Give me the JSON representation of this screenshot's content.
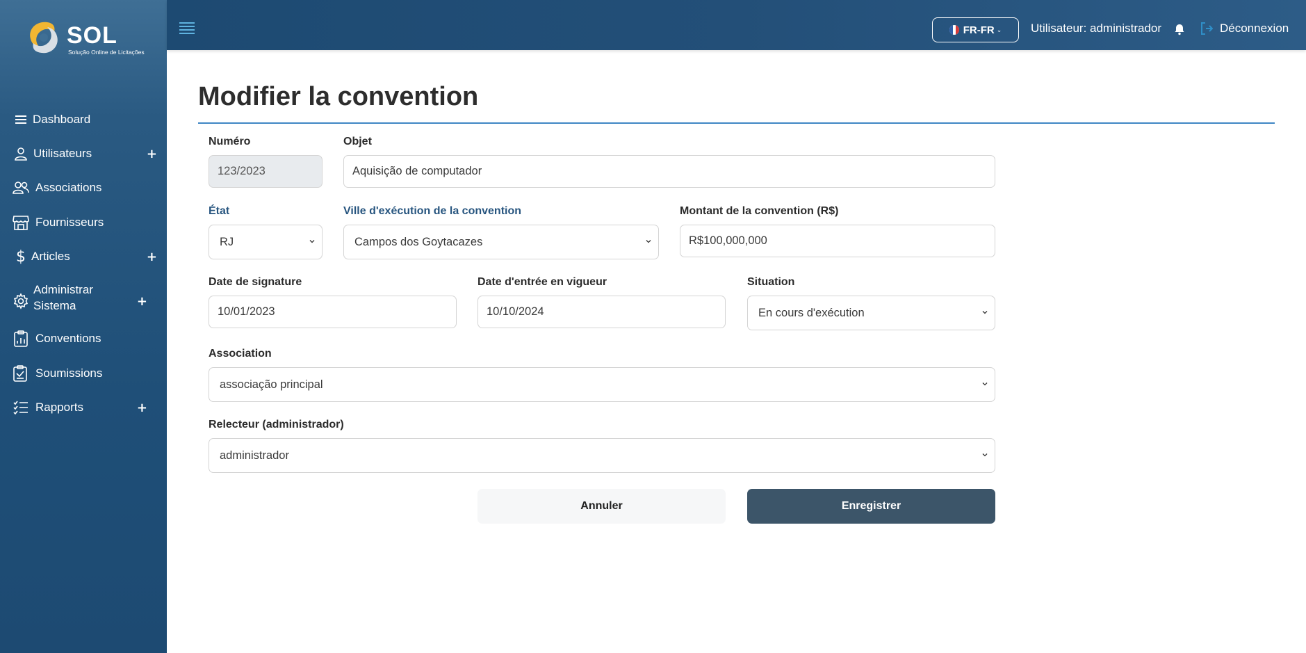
{
  "app": {
    "brand": "SOL",
    "tagline": "Solução Online de Licitações"
  },
  "sidebar": {
    "items": [
      {
        "label": "Dashboard",
        "icon": "list-icon",
        "expandable": false
      },
      {
        "label": "Utilisateurs",
        "icon": "user-icon",
        "expandable": true
      },
      {
        "label": "Associations",
        "icon": "users-group-icon",
        "expandable": false
      },
      {
        "label": "Fournisseurs",
        "icon": "store-icon",
        "expandable": false
      },
      {
        "label": "Articles",
        "icon": "dollar-icon",
        "expandable": true
      },
      {
        "label": "Administrar Sistema",
        "icon": "gear-icon",
        "expandable": true
      },
      {
        "label": "Conventions",
        "icon": "report-chart-icon",
        "expandable": false
      },
      {
        "label": "Soumissions",
        "icon": "clipboard-icon",
        "expandable": false
      },
      {
        "label": "Rapports",
        "icon": "checklist-icon",
        "expandable": true
      }
    ],
    "plus_symbol": "+"
  },
  "topbar": {
    "language": "FR-FR",
    "user": "Utilisateur: administrador",
    "logout": "Déconnexion"
  },
  "page": {
    "title": "Modifier la convention"
  },
  "form": {
    "numero": {
      "label": "Numéro",
      "value": "123/2023"
    },
    "objet": {
      "label": "Objet",
      "value": "Aquisição de computador"
    },
    "etat": {
      "label": "État",
      "value": "RJ"
    },
    "ville": {
      "label": "Ville d'exécution de la convention",
      "value": "Campos dos Goytacazes"
    },
    "montant": {
      "label": "Montant de la convention (R$)",
      "value": "R$100,000,000"
    },
    "date_signature": {
      "label": "Date de signature",
      "value": "10/01/2023"
    },
    "date_vigueur": {
      "label": "Date d'entrée en vigueur",
      "value": "10/10/2024"
    },
    "situation": {
      "label": "Situation",
      "value": "En cours d'exécution"
    },
    "association": {
      "label": "Association",
      "value": "associação principal"
    },
    "relecteur": {
      "label": "Relecteur (administrador)",
      "value": "administrador"
    }
  },
  "actions": {
    "cancel": "Annuler",
    "save": "Enregistrer"
  },
  "colors": {
    "sidebar": "#1f4f78",
    "topbar": "#234f78",
    "accent_rule": "#3f86c4",
    "save_button": "#3c5569",
    "blue_label": "#27557f",
    "logo_yellow": "#f2b632"
  }
}
